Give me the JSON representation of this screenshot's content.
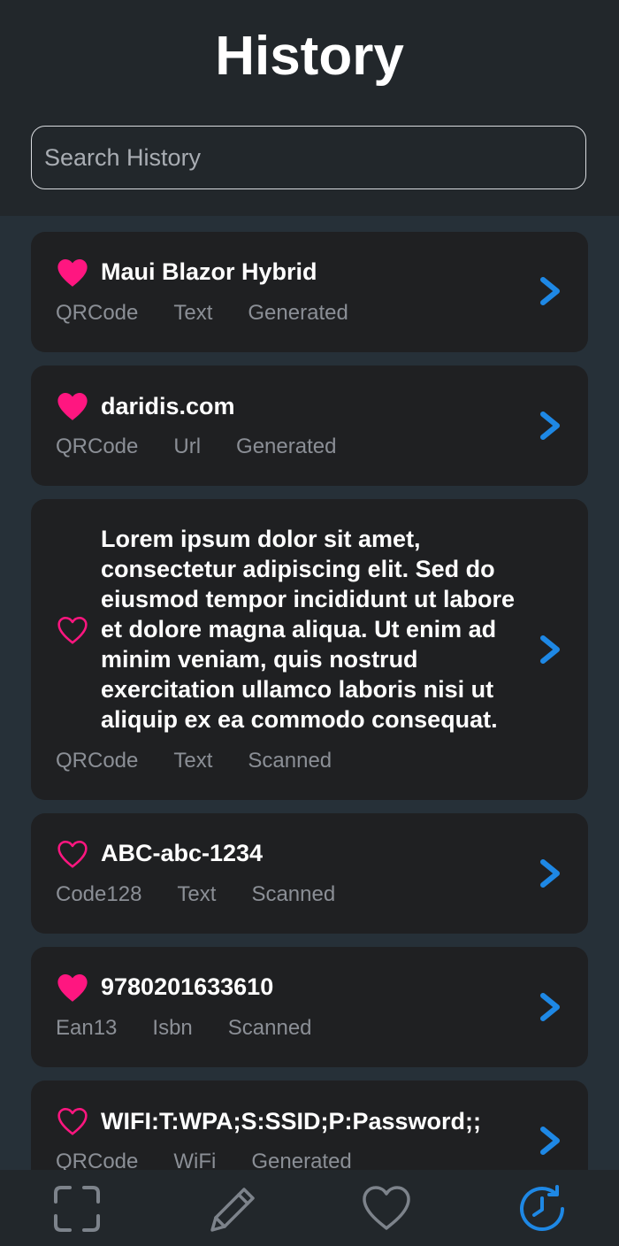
{
  "header": {
    "title": "History"
  },
  "search": {
    "placeholder": "Search History",
    "value": ""
  },
  "items": [
    {
      "title": "Maui Blazor Hybrid",
      "favorite": true,
      "format": "QRCode",
      "type": "Text",
      "source": "Generated"
    },
    {
      "title": "daridis.com",
      "favorite": true,
      "format": "QRCode",
      "type": "Url",
      "source": "Generated"
    },
    {
      "title": "Lorem ipsum dolor sit amet,\nconsectetur adipiscing elit. Sed do\neiusmod tempor incididunt ut labore\net dolore magna aliqua. Ut enim ad\nminim veniam, quis nostrud\nexercitation ullamco laboris nisi ut\naliquip ex ea commodo consequat.",
      "favorite": false,
      "format": "QRCode",
      "type": "Text",
      "source": "Scanned"
    },
    {
      "title": "ABC-abc-1234",
      "favorite": false,
      "format": "Code128",
      "type": "Text",
      "source": "Scanned"
    },
    {
      "title": "9780201633610",
      "favorite": true,
      "format": "Ean13",
      "type": "Isbn",
      "source": "Scanned"
    },
    {
      "title": "WIFI:T:WPA;S:SSID;P:Password;;",
      "favorite": false,
      "format": "QRCode",
      "type": "WiFi",
      "source": "Generated"
    }
  ],
  "icons": {
    "favorite_on": "heart-filled-icon",
    "favorite_off": "heart-outline-icon",
    "open": "chevron-right-icon"
  },
  "nav": {
    "items": [
      {
        "name": "scan",
        "icon": "scan-frame-icon",
        "active": false
      },
      {
        "name": "create",
        "icon": "pencil-icon",
        "active": false
      },
      {
        "name": "favorites",
        "icon": "heart-outline-icon",
        "active": false
      },
      {
        "name": "history",
        "icon": "history-clock-icon",
        "active": true
      }
    ]
  },
  "colors": {
    "accent": "#1e88e5",
    "favorite": "#ff1680",
    "header_bg": "#22272b",
    "list_bg": "#263038",
    "card_bg": "#1f2022",
    "meta_text": "#8b8f96"
  }
}
